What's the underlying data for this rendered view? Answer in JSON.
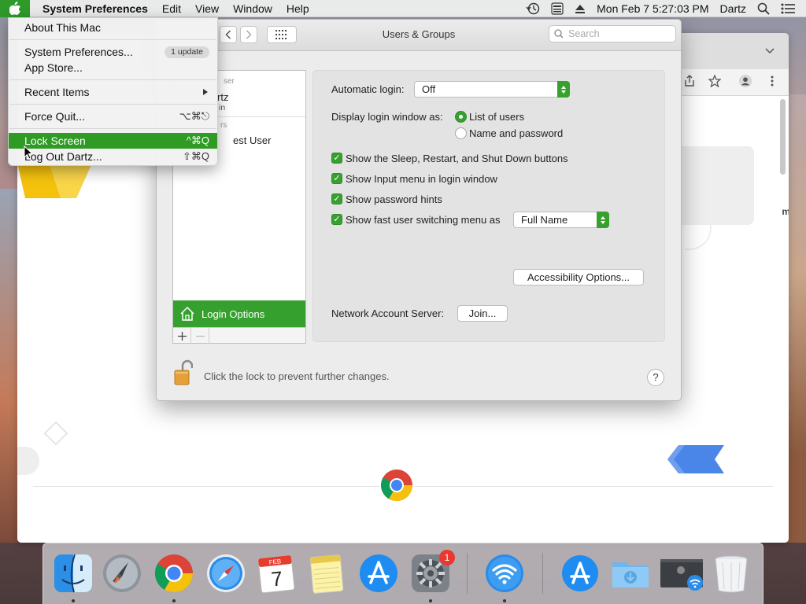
{
  "menubar": {
    "app_name": "System Preferences",
    "items": [
      "Edit",
      "View",
      "Window",
      "Help"
    ],
    "datetime": "Mon Feb 7  5:27:03 PM",
    "user": "Dartz"
  },
  "apple_menu": {
    "about": "About This Mac",
    "sysprefs": "System Preferences...",
    "update_badge": "1 update",
    "appstore": "App Store...",
    "recent": "Recent Items",
    "force_quit": "Force Quit...",
    "force_quit_shortcut": "⌥⌘⎋",
    "lock_screen": "Lock Screen",
    "lock_screen_shortcut": "^⌘Q",
    "logout": "Log Out Dartz...",
    "logout_shortcut": "⇧⌘Q"
  },
  "window": {
    "title": "Users & Groups",
    "search_placeholder": "Search"
  },
  "users_panel": {
    "current_section": "ser",
    "user_name": "rtz",
    "user_role": "in",
    "other_section": "rs",
    "guest": "est User",
    "login_options": "Login Options"
  },
  "settings": {
    "auto_login_label": "Automatic login:",
    "auto_login_value": "Off",
    "display_label": "Display login window as:",
    "radio_list": "List of users",
    "radio_name": "Name and password",
    "chk_sleep": "Show the Sleep, Restart, and Shut Down buttons",
    "chk_input": "Show Input menu in login window",
    "chk_hints": "Show password hints",
    "chk_fast": "Show fast user switching menu as",
    "fast_value": "Full Name",
    "accessibility_btn": "Accessibility Options...",
    "network_label": "Network Account Server:",
    "join_btn": "Join..."
  },
  "footer": {
    "lock_text": "Click the lock to prevent further changes.",
    "help": "?"
  },
  "dock": {
    "calendar_month": "FEB",
    "calendar_day": "7",
    "sysprefs_badge": "1"
  },
  "colors": {
    "accent_green": "#37a02f",
    "menu_highlight": "#2f9a24",
    "badge_red": "#e8382f"
  }
}
